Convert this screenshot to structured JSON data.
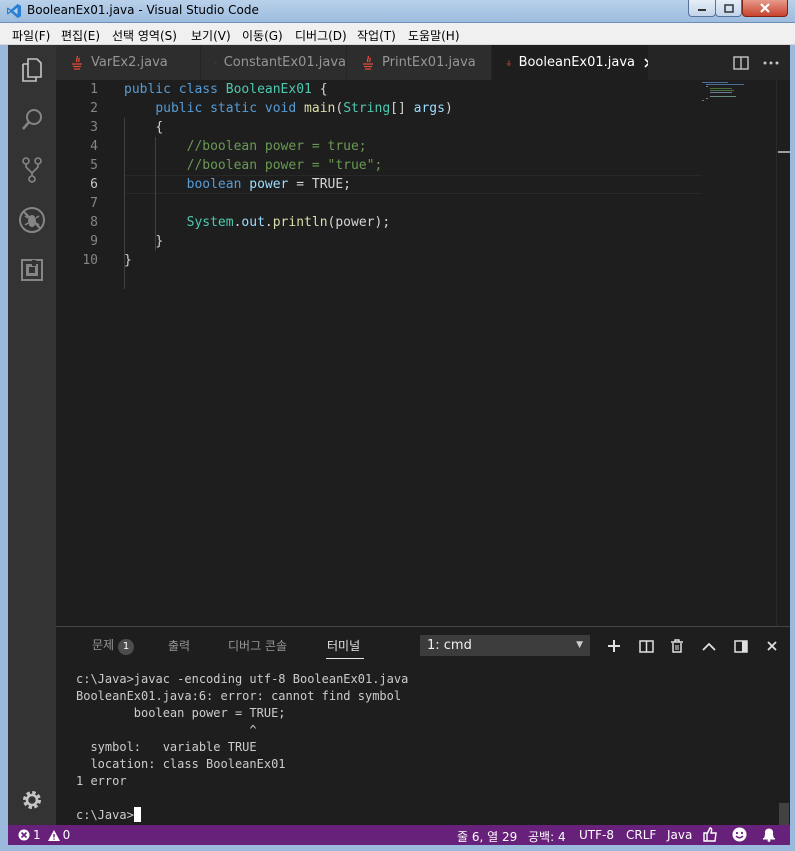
{
  "window": {
    "title": "BooleanEx01.java - Visual Studio Code"
  },
  "menubar": {
    "items": [
      "파일(F)",
      "편집(E)",
      "선택 영역(S)",
      "보기(V)",
      "이동(G)",
      "디버그(D)",
      "작업(T)",
      "도움말(H)"
    ]
  },
  "activity_bar": {
    "items": [
      "explorer-icon",
      "search-icon",
      "source-control-icon",
      "debug-icon",
      "extensions-icon"
    ],
    "bottom": "gear-icon"
  },
  "tabs": [
    {
      "label": "VarEx2.java",
      "active": false
    },
    {
      "label": "ConstantEx01.java",
      "active": false
    },
    {
      "label": "PrintEx01.java",
      "active": false
    },
    {
      "label": "BooleanEx01.java",
      "active": true
    }
  ],
  "editor": {
    "current_line": 6,
    "lines": [
      {
        "n": "1",
        "code": "public class BooleanEx01 {"
      },
      {
        "n": "2",
        "code": "    public static void main(String[] args)"
      },
      {
        "n": "3",
        "code": "    {"
      },
      {
        "n": "4",
        "code": "        //boolean power = true;"
      },
      {
        "n": "5",
        "code": "        //boolean power = \"true\";"
      },
      {
        "n": "6",
        "code": "        boolean power = TRUE;"
      },
      {
        "n": "7",
        "code": ""
      },
      {
        "n": "8",
        "code": "        System.out.println(power);"
      },
      {
        "n": "9",
        "code": "    }"
      },
      {
        "n": "10",
        "code": "}"
      }
    ]
  },
  "panel": {
    "tabs": [
      {
        "label": "문제",
        "badge": "1"
      },
      {
        "label": "출력"
      },
      {
        "label": "디버그 콘솔"
      },
      {
        "label": "터미널",
        "active": true
      }
    ],
    "terminal_select": "1: cmd",
    "terminal_lines": [
      "c:\\Java>javac -encoding utf-8 BooleanEx01.java",
      "BooleanEx01.java:6: error: cannot find symbol",
      "        boolean power = TRUE;",
      "                        ^",
      "  symbol:   variable TRUE",
      "  location: class BooleanEx01",
      "1 error",
      ""
    ],
    "prompt": "c:\\Java>"
  },
  "statusbar": {
    "errors": "1",
    "warnings": "0",
    "position": "줄 6, 열 29",
    "indent": "공백: 4",
    "encoding": "UTF-8",
    "eol": "CRLF",
    "language": "Java"
  },
  "colors": {
    "statusbar": "#68217a",
    "editor_bg": "#1e1e1e",
    "keyword": "#569cd6",
    "type": "#4ec9b0",
    "comment": "#6a9955"
  }
}
